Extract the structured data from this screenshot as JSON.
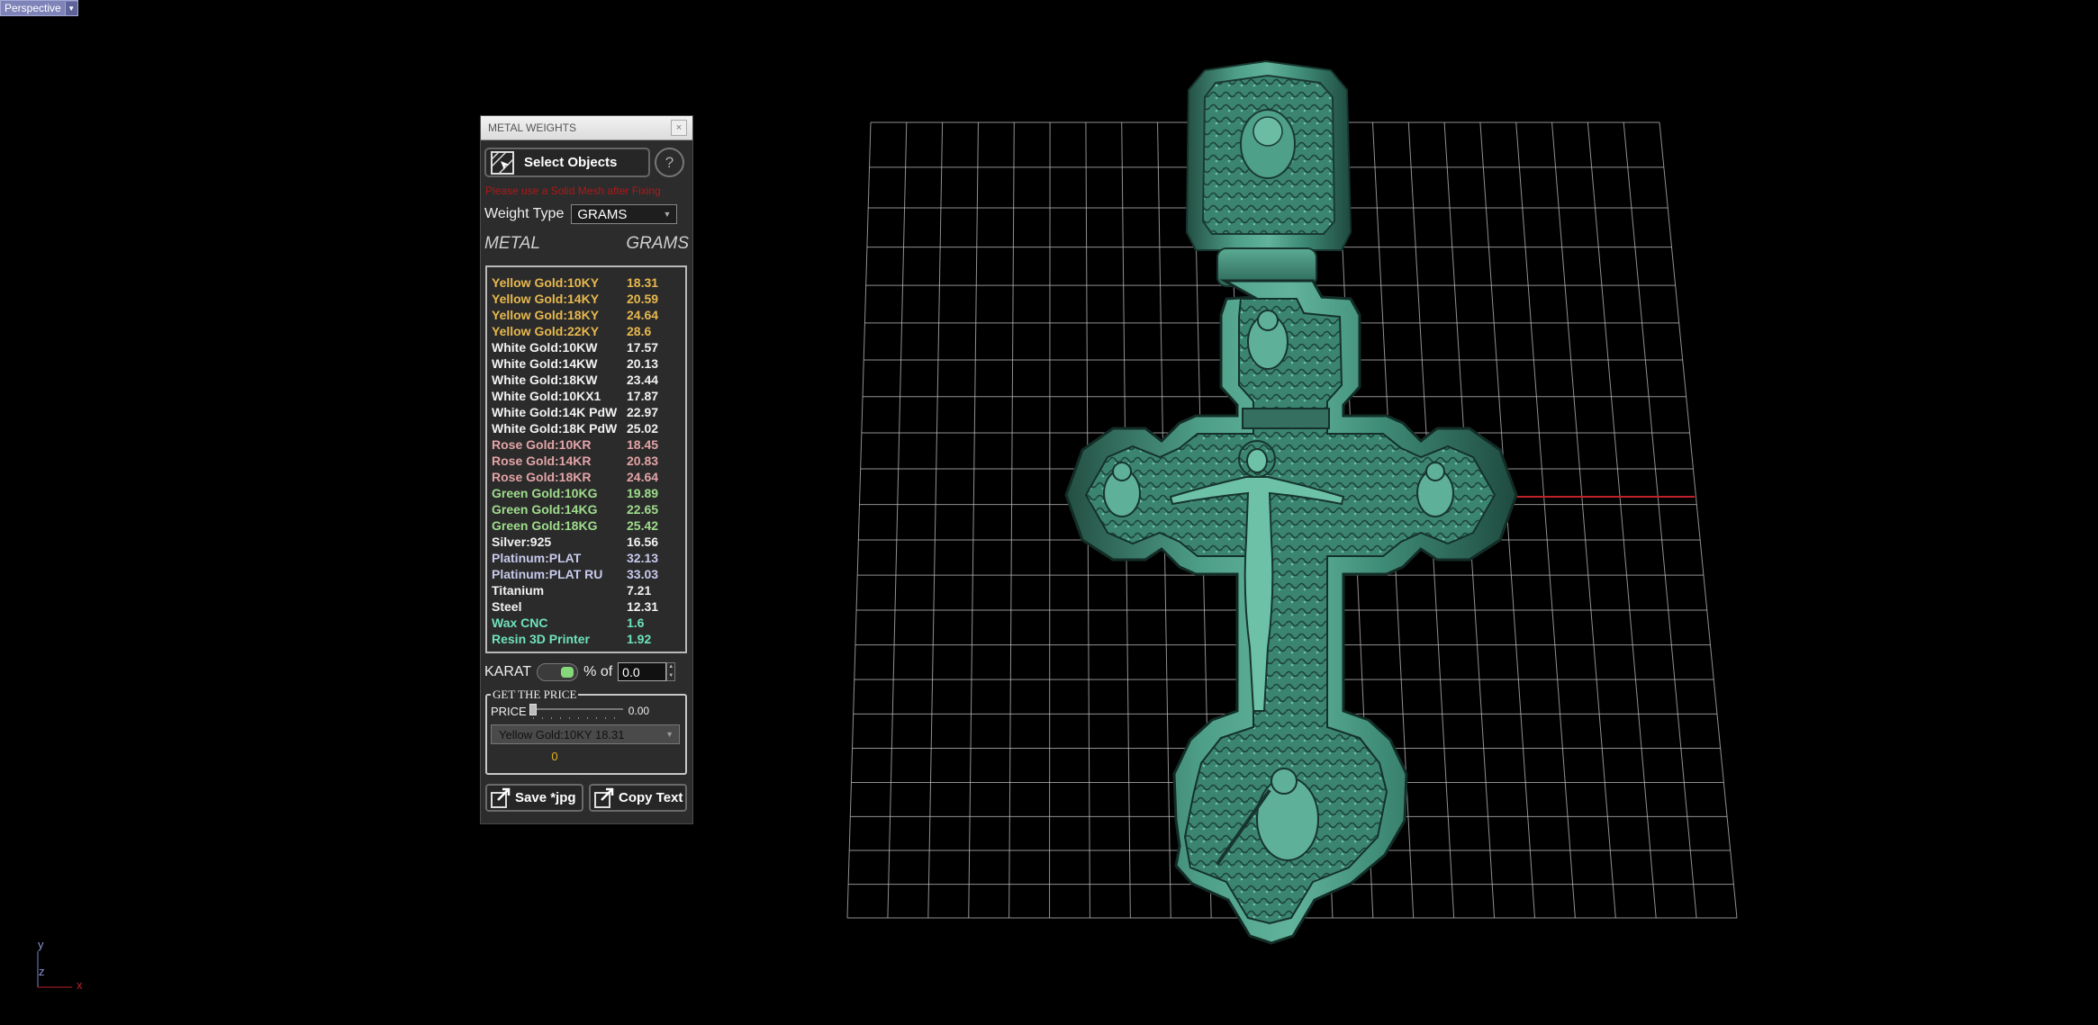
{
  "viewport": {
    "label": "Perspective"
  },
  "axes": {
    "y": "y",
    "z": "z",
    "x": "x"
  },
  "panel": {
    "title": "METAL WEIGHTS",
    "close_glyph": "×",
    "select_label": "Select Objects",
    "help_glyph": "?",
    "warning": "Please use a Solid Mesh after Fixing",
    "weight_type_label": "Weight Type",
    "weight_type_value": "GRAMS",
    "col_metal": "METAL",
    "col_grams": "GRAMS",
    "metals": [
      {
        "name": "Yellow Gold:10KY",
        "value": "18.31",
        "color": "#e7b84e"
      },
      {
        "name": "Yellow Gold:14KY",
        "value": "20.59",
        "color": "#e7b84e"
      },
      {
        "name": "Yellow Gold:18KY",
        "value": "24.64",
        "color": "#e7b84e"
      },
      {
        "name": "Yellow Gold:22KY",
        "value": "28.6",
        "color": "#e7b84e"
      },
      {
        "name": "White Gold:10KW",
        "value": "17.57",
        "color": "#f2f2f2"
      },
      {
        "name": "White Gold:14KW",
        "value": "20.13",
        "color": "#f2f2f2"
      },
      {
        "name": "White Gold:18KW",
        "value": "23.44",
        "color": "#f2f2f2"
      },
      {
        "name": "White Gold:10KX1",
        "value": "17.87",
        "color": "#f2f2f2"
      },
      {
        "name": "White Gold:14K PdW",
        "value": "22.97",
        "color": "#f2f2f2"
      },
      {
        "name": "White Gold:18K PdW",
        "value": "25.02",
        "color": "#f2f2f2"
      },
      {
        "name": "Rose Gold:10KR",
        "value": "18.45",
        "color": "#e3a3a7"
      },
      {
        "name": "Rose Gold:14KR",
        "value": "20.83",
        "color": "#e3a3a7"
      },
      {
        "name": "Rose Gold:18KR",
        "value": "24.64",
        "color": "#e3a3a7"
      },
      {
        "name": "Green Gold:10KG",
        "value": "19.89",
        "color": "#9fdc8c"
      },
      {
        "name": "Green Gold:14KG",
        "value": "22.65",
        "color": "#9fdc8c"
      },
      {
        "name": "Green Gold:18KG",
        "value": "25.42",
        "color": "#9fdc8c"
      },
      {
        "name": "Silver:925",
        "value": "16.56",
        "color": "#f2f2f2"
      },
      {
        "name": "Platinum:PLAT",
        "value": "32.13",
        "color": "#c7c9ec"
      },
      {
        "name": "Platinum:PLAT RU",
        "value": "33.03",
        "color": "#c7c9ec"
      },
      {
        "name": "Titanium",
        "value": "7.21",
        "color": "#f2f2f2"
      },
      {
        "name": "Steel",
        "value": "12.31",
        "color": "#f2f2f2"
      },
      {
        "name": "Wax  CNC",
        "value": "1.6",
        "color": "#6fe2bd"
      },
      {
        "name": "Resin 3D Printer",
        "value": "1.92",
        "color": "#6fe2bd"
      }
    ],
    "karat_label": "KARAT",
    "pct_label": "% of",
    "pct_value": "0.0",
    "price_group": "GET THE PRICE",
    "price_label": "PRICE",
    "price_value": "0.00",
    "selected_metal": "Yellow Gold:10KY 18.31",
    "result": "0",
    "save_label": "Save *jpg",
    "copy_label": "Copy  Text"
  },
  "colors": {
    "model": "#3f8c77",
    "grid": "#bfbfbf",
    "x_axis": "#c0202a"
  }
}
